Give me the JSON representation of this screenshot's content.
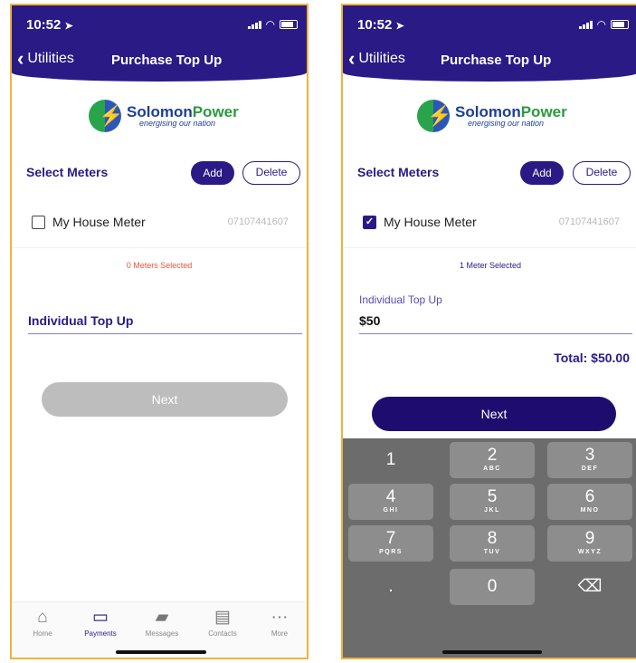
{
  "status": {
    "time": "10:52",
    "location_arrow": "➤"
  },
  "nav": {
    "back_label": "Utilities",
    "title": "Purchase Top Up"
  },
  "brand": {
    "name_part1": "Solomon",
    "name_part2": "Power",
    "tagline": "energising our nation"
  },
  "meters": {
    "section_title": "Select Meters",
    "add_label": "Add",
    "delete_label": "Delete",
    "item_name": "My House Meter",
    "item_number": "07107441607"
  },
  "left_screen": {
    "selected_text": "0 Meters Selected",
    "field_label": "Individual Top Up",
    "next_label": "Next"
  },
  "right_screen": {
    "selected_text": "1 Meter Selected",
    "field_label": "Individual Top Up",
    "field_value": "$50",
    "total": "Total: $50.00",
    "next_label": "Next"
  },
  "tabbar": {
    "home": "Home",
    "payments": "Payments",
    "messages": "Messages",
    "contacts": "Contacts",
    "more": "More"
  },
  "keyboard": {
    "keys": [
      {
        "digit": "1",
        "letters": ""
      },
      {
        "digit": "2",
        "letters": "ABC"
      },
      {
        "digit": "3",
        "letters": "DEF"
      },
      {
        "digit": "4",
        "letters": "GHI"
      },
      {
        "digit": "5",
        "letters": "JKL"
      },
      {
        "digit": "6",
        "letters": "MNO"
      },
      {
        "digit": "7",
        "letters": "PQRS"
      },
      {
        "digit": "8",
        "letters": "TUV"
      },
      {
        "digit": "9",
        "letters": "WXYZ"
      },
      {
        "digit": ".",
        "letters": ""
      },
      {
        "digit": "0",
        "letters": ""
      },
      {
        "digit": "⌫",
        "letters": ""
      }
    ]
  },
  "colors": {
    "primary": "#2a1a86",
    "accent_border": "#f0b33a",
    "warning_text": "#e8553e",
    "disabled": "#bdbdbd"
  }
}
